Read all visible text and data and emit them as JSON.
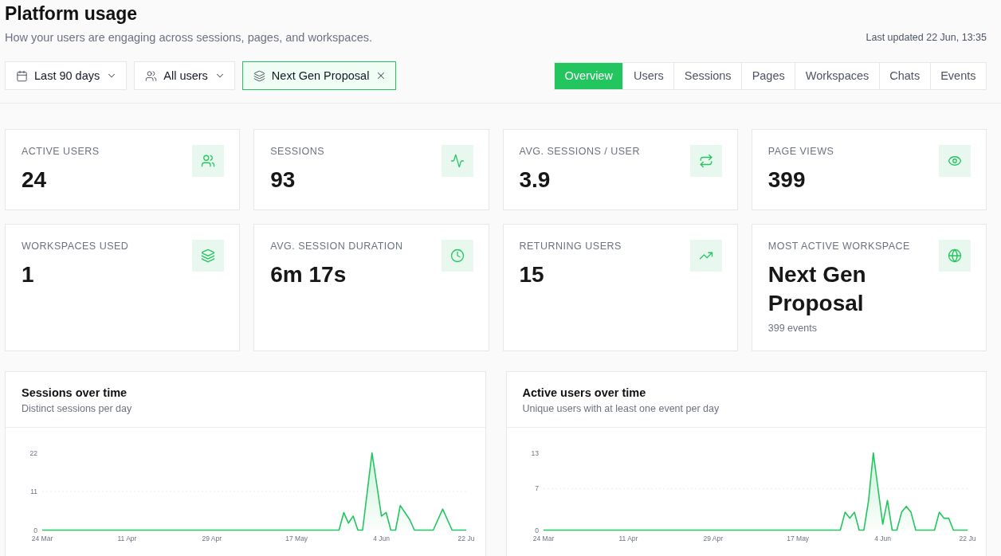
{
  "header": {
    "title": "Platform usage",
    "subtitle": "How your users are engaging across sessions, pages, and workspaces.",
    "last_updated": "Last updated 22 Jun, 13:35"
  },
  "filters": [
    {
      "kind": "dropdown",
      "label": "Last 90 days"
    },
    {
      "kind": "dropdown",
      "label": "All users"
    },
    {
      "kind": "chip",
      "label": "Next Gen Proposal"
    }
  ],
  "tabs": [
    {
      "label": "Overview",
      "selected": true
    },
    {
      "label": "Users",
      "selected": false
    },
    {
      "label": "Sessions",
      "selected": false
    },
    {
      "label": "Pages",
      "selected": false
    },
    {
      "label": "Workspaces",
      "selected": false
    },
    {
      "label": "Chats",
      "selected": false
    },
    {
      "label": "Events",
      "selected": false
    }
  ],
  "stats": [
    {
      "label": "ACTIVE USERS",
      "value": "24"
    },
    {
      "label": "SESSIONS",
      "value": "93"
    },
    {
      "label": "AVG. SESSIONS / USER",
      "value": "3.9"
    },
    {
      "label": "PAGE VIEWS",
      "value": "399"
    },
    {
      "label": "WORKSPACES USED",
      "value": "1"
    },
    {
      "label": "AVG. SESSION DURATION",
      "value": "6m 17s"
    },
    {
      "label": "RETURNING USERS",
      "value": "15"
    },
    {
      "label": "MOST ACTIVE WORKSPACE",
      "value": "Next Gen Proposal",
      "note": "399 events"
    }
  ],
  "charts": [
    {
      "subtitle": "Distinct sessions per day",
      "chart_data": {
        "type": "area",
        "title": "Sessions over time",
        "categories": [
          "24 Mar",
          null,
          null,
          null,
          null,
          null,
          null,
          null,
          null,
          null,
          null,
          null,
          null,
          null,
          null,
          null,
          null,
          null,
          "11 Apr",
          null,
          null,
          null,
          null,
          null,
          null,
          null,
          null,
          null,
          null,
          null,
          null,
          null,
          null,
          null,
          null,
          null,
          "29 Apr",
          null,
          null,
          null,
          null,
          null,
          null,
          null,
          null,
          null,
          null,
          null,
          null,
          null,
          null,
          null,
          null,
          null,
          "17 May",
          null,
          null,
          null,
          null,
          null,
          null,
          null,
          null,
          null,
          null,
          null,
          null,
          null,
          null,
          null,
          null,
          null,
          "4 Jun",
          null,
          null,
          null,
          null,
          null,
          null,
          null,
          null,
          null,
          null,
          null,
          null,
          null,
          null,
          null,
          null,
          null,
          "22 Ju"
        ],
        "ylim": [
          0,
          22
        ],
        "yticks": [
          0,
          11,
          22
        ],
        "series": [
          {
            "color": "#22c55e",
            "values": [
              0,
              0,
              0,
              0,
              0,
              0,
              0,
              0,
              0,
              0,
              0,
              0,
              0,
              0,
              0,
              0,
              0,
              0,
              0,
              0,
              0,
              0,
              0,
              0,
              0,
              0,
              0,
              0,
              0,
              0,
              0,
              0,
              0,
              0,
              0,
              0,
              0,
              0,
              0,
              0,
              0,
              0,
              0,
              0,
              0,
              0,
              0,
              0,
              0,
              0,
              0,
              0,
              0,
              0,
              0,
              0,
              0,
              0,
              0,
              0,
              0,
              0,
              0,
              0,
              5,
              2,
              4,
              0,
              0,
              11,
              22,
              13,
              4,
              5,
              0,
              0,
              7,
              5,
              3,
              0,
              0,
              0,
              0,
              0,
              3,
              6,
              3,
              0,
              0,
              0,
              0
            ]
          }
        ]
      }
    },
    {
      "subtitle": "Unique users with at least one event per day",
      "chart_data": {
        "type": "area",
        "title": "Active users over time",
        "categories": [
          "24 Mar",
          null,
          null,
          null,
          null,
          null,
          null,
          null,
          null,
          null,
          null,
          null,
          null,
          null,
          null,
          null,
          null,
          null,
          "11 Apr",
          null,
          null,
          null,
          null,
          null,
          null,
          null,
          null,
          null,
          null,
          null,
          null,
          null,
          null,
          null,
          null,
          null,
          "29 Apr",
          null,
          null,
          null,
          null,
          null,
          null,
          null,
          null,
          null,
          null,
          null,
          null,
          null,
          null,
          null,
          null,
          null,
          "17 May",
          null,
          null,
          null,
          null,
          null,
          null,
          null,
          null,
          null,
          null,
          null,
          null,
          null,
          null,
          null,
          null,
          null,
          "4 Jun",
          null,
          null,
          null,
          null,
          null,
          null,
          null,
          null,
          null,
          null,
          null,
          null,
          null,
          null,
          null,
          null,
          null,
          "22 Ju"
        ],
        "ylim": [
          0,
          13
        ],
        "yticks": [
          0,
          7,
          13
        ],
        "series": [
          {
            "color": "#22c55e",
            "values": [
              0,
              0,
              0,
              0,
              0,
              0,
              0,
              0,
              0,
              0,
              0,
              0,
              0,
              0,
              0,
              0,
              0,
              0,
              0,
              0,
              0,
              0,
              0,
              0,
              0,
              0,
              0,
              0,
              0,
              0,
              0,
              0,
              0,
              0,
              0,
              0,
              0,
              0,
              0,
              0,
              0,
              0,
              0,
              0,
              0,
              0,
              0,
              0,
              0,
              0,
              0,
              0,
              0,
              0,
              0,
              0,
              0,
              0,
              0,
              0,
              0,
              0,
              0,
              0,
              3,
              2,
              3,
              0,
              0,
              5,
              13,
              7,
              1,
              5,
              0,
              0,
              3,
              4,
              3,
              0,
              0,
              0,
              0,
              0,
              3,
              2,
              2,
              0,
              0,
              0,
              0
            ]
          }
        ]
      }
    }
  ]
}
